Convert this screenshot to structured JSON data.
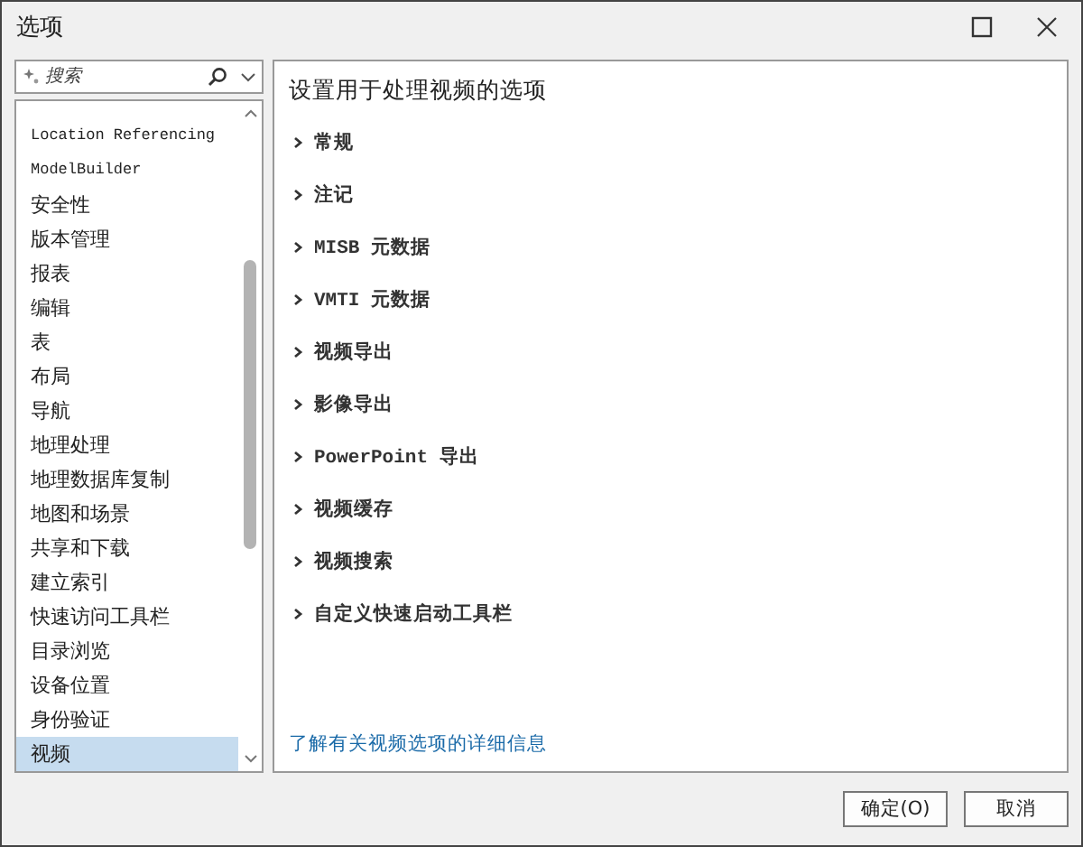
{
  "window": {
    "title": "选项"
  },
  "search": {
    "placeholder": "搜索"
  },
  "sidebar": {
    "items": [
      {
        "label": "Location Referencing",
        "selected": false
      },
      {
        "label": "ModelBuilder",
        "selected": false
      },
      {
        "label": "安全性",
        "selected": false
      },
      {
        "label": "版本管理",
        "selected": false
      },
      {
        "label": "报表",
        "selected": false
      },
      {
        "label": "编辑",
        "selected": false
      },
      {
        "label": "表",
        "selected": false
      },
      {
        "label": "布局",
        "selected": false
      },
      {
        "label": "导航",
        "selected": false
      },
      {
        "label": "地理处理",
        "selected": false
      },
      {
        "label": "地理数据库复制",
        "selected": false
      },
      {
        "label": "地图和场景",
        "selected": false
      },
      {
        "label": "共享和下载",
        "selected": false
      },
      {
        "label": "建立索引",
        "selected": false
      },
      {
        "label": "快速访问工具栏",
        "selected": false
      },
      {
        "label": "目录浏览",
        "selected": false
      },
      {
        "label": "设备位置",
        "selected": false
      },
      {
        "label": "身份验证",
        "selected": false
      },
      {
        "label": "视频",
        "selected": true
      }
    ]
  },
  "panel": {
    "heading": "设置用于处理视频的选项",
    "sections": [
      {
        "label": "常规",
        "expanded": false
      },
      {
        "label": "注记",
        "expanded": false
      },
      {
        "label": "MISB 元数据",
        "expanded": false
      },
      {
        "label": "VMTI 元数据",
        "expanded": false
      },
      {
        "label": "视频导出",
        "expanded": false
      },
      {
        "label": "影像导出",
        "expanded": false
      },
      {
        "label": "PowerPoint 导出",
        "expanded": false
      },
      {
        "label": "视频缓存",
        "expanded": false
      },
      {
        "label": "视频搜索",
        "expanded": false
      },
      {
        "label": "自定义快速启动工具栏",
        "expanded": false
      }
    ],
    "link": "了解有关视频选项的详细信息"
  },
  "buttons": [
    "确定(O)",
    "取消"
  ]
}
